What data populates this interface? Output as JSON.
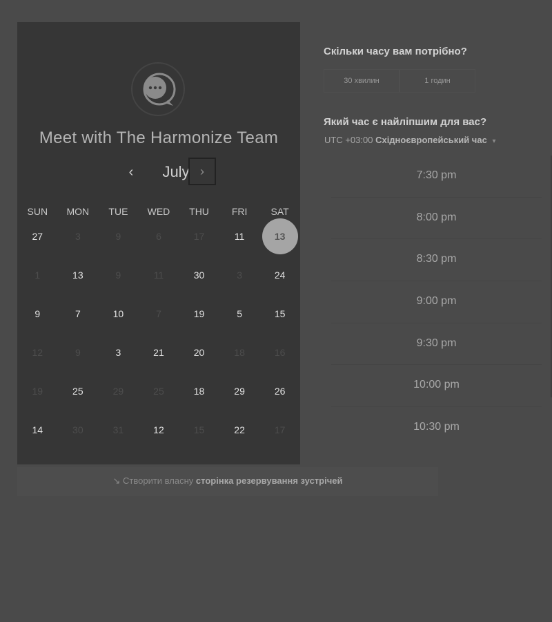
{
  "team_title": "Meet with The Harmonize Team",
  "month": "July",
  "nav": {
    "prev": "‹",
    "next": "›"
  },
  "weekdays": [
    "SUN",
    "MON",
    "TUE",
    "WED",
    "THU",
    "FRI",
    "SAT"
  ],
  "weeks": [
    [
      {
        "d": "27",
        "a": true
      },
      {
        "d": "3",
        "a": false
      },
      {
        "d": "9",
        "a": false
      },
      {
        "d": "6",
        "a": false
      },
      {
        "d": "17",
        "a": false
      },
      {
        "d": "11",
        "a": true
      },
      {
        "d": "13",
        "a": true,
        "sel": true
      }
    ],
    [
      {
        "d": "1",
        "a": false
      },
      {
        "d": "13",
        "a": true
      },
      {
        "d": "9",
        "a": false
      },
      {
        "d": "11",
        "a": false
      },
      {
        "d": "30",
        "a": true
      },
      {
        "d": "3",
        "a": false
      },
      {
        "d": "24",
        "a": true
      }
    ],
    [
      {
        "d": "9",
        "a": true
      },
      {
        "d": "7",
        "a": true
      },
      {
        "d": "10",
        "a": true
      },
      {
        "d": "7",
        "a": false
      },
      {
        "d": "19",
        "a": true
      },
      {
        "d": "5",
        "a": true
      },
      {
        "d": "15",
        "a": true
      }
    ],
    [
      {
        "d": "12",
        "a": false
      },
      {
        "d": "9",
        "a": false
      },
      {
        "d": "3",
        "a": true
      },
      {
        "d": "21",
        "a": true
      },
      {
        "d": "20",
        "a": true
      },
      {
        "d": "18",
        "a": false
      },
      {
        "d": "16",
        "a": false
      }
    ],
    [
      {
        "d": "19",
        "a": false
      },
      {
        "d": "25",
        "a": true
      },
      {
        "d": "29",
        "a": false
      },
      {
        "d": "25",
        "a": false
      },
      {
        "d": "18",
        "a": true
      },
      {
        "d": "29",
        "a": true
      },
      {
        "d": "26",
        "a": true
      }
    ],
    [
      {
        "d": "14",
        "a": true
      },
      {
        "d": "30",
        "a": false
      },
      {
        "d": "31",
        "a": false
      },
      {
        "d": "12",
        "a": true
      },
      {
        "d": "15",
        "a": false
      },
      {
        "d": "22",
        "a": true
      },
      {
        "d": "17",
        "a": false
      }
    ]
  ],
  "duration_question": "Скільки часу вам потрібно?",
  "durations": [
    "30 хвилин",
    "1 годин"
  ],
  "time_question": "Який час є найліпшим для вас?",
  "timezone": {
    "offset": "UTC +03:00",
    "name": "Східноєвропейський час",
    "caret": "▾"
  },
  "slots": [
    "7:30 pm",
    "8:00 pm",
    "8:30 pm",
    "9:00 pm",
    "9:30 pm",
    "10:00 pm",
    "10:30 pm"
  ],
  "footer": {
    "icon": "↘",
    "text": "Створити власну",
    "link": "сторінка резервування зустрічей"
  }
}
